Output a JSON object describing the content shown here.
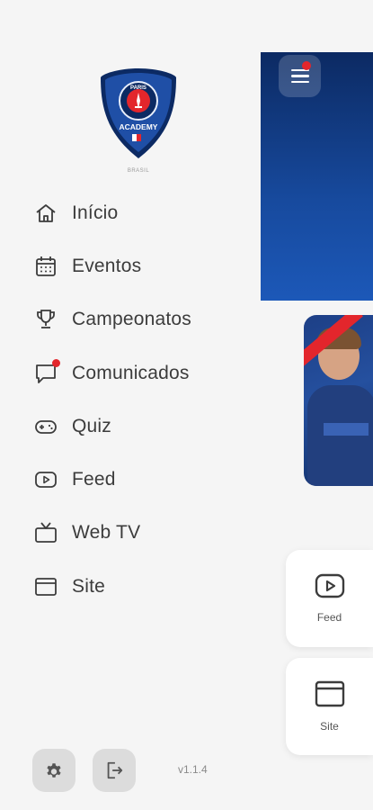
{
  "drawer": {
    "logo_text_top": "PARIS",
    "logo_text_bottom": "ACADEMY",
    "logo_subtitle": "BRASIL",
    "items": [
      {
        "label": "Início",
        "icon": "home-icon",
        "has_badge": false
      },
      {
        "label": "Eventos",
        "icon": "calendar-icon",
        "has_badge": false
      },
      {
        "label": "Campeonatos",
        "icon": "trophy-icon",
        "has_badge": false
      },
      {
        "label": "Comunicados",
        "icon": "chat-icon",
        "has_badge": true
      },
      {
        "label": "Quiz",
        "icon": "gamepad-icon",
        "has_badge": false
      },
      {
        "label": "Feed",
        "icon": "video-play-icon",
        "has_badge": false
      },
      {
        "label": "Web TV",
        "icon": "tv-icon",
        "has_badge": false
      },
      {
        "label": "Site",
        "icon": "browser-window-icon",
        "has_badge": false
      }
    ],
    "footer": {
      "settings_icon": "gear-icon",
      "logout_icon": "logout-icon",
      "version": "v1.1.4"
    }
  },
  "background": {
    "quick_links": [
      {
        "label": "Feed",
        "icon": "video-play-icon"
      },
      {
        "label": "Site",
        "icon": "browser-window-icon"
      }
    ]
  },
  "colors": {
    "brand_navy": "#0c2a63",
    "accent_red": "#e3262c",
    "background": "#f5f5f5",
    "text": "#3c3c3c"
  }
}
